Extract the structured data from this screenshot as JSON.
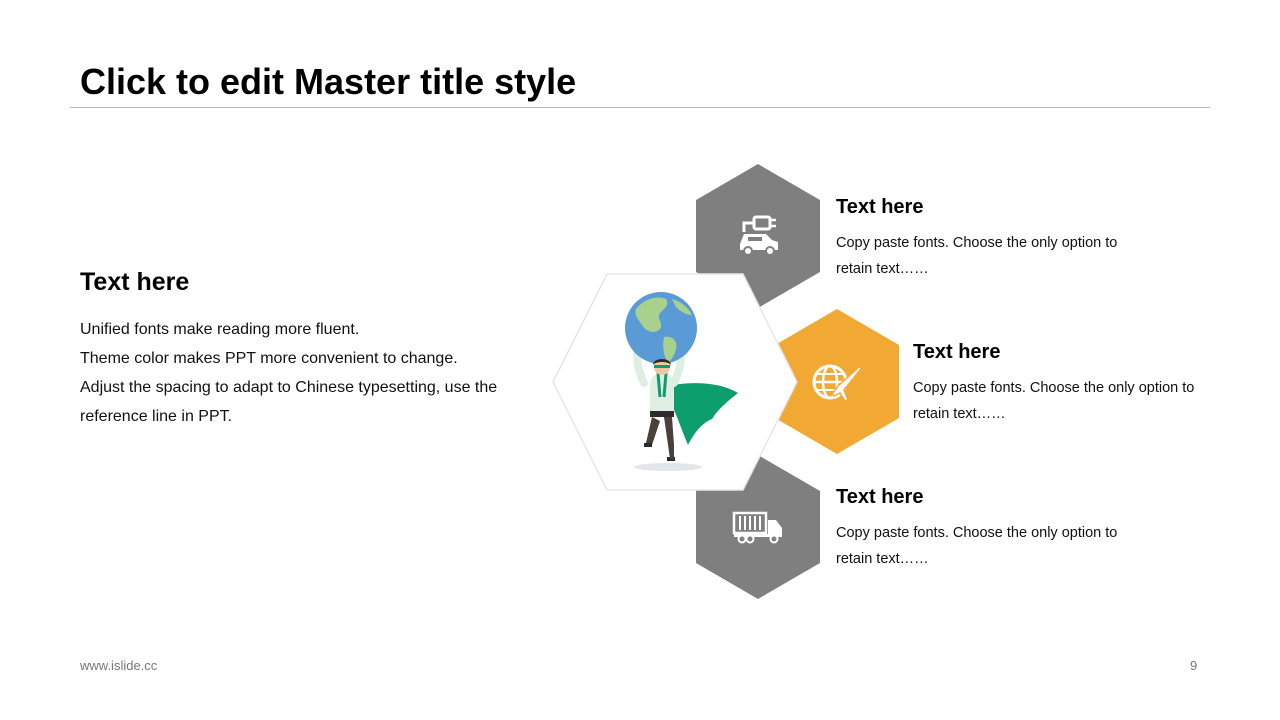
{
  "slide": {
    "title": "Click to edit Master title style",
    "footer_url": "www.islide.cc",
    "page_number": "9"
  },
  "left": {
    "heading": "Text here",
    "lines": [
      "Unified fonts make reading more fluent.",
      "Theme color makes PPT more convenient to change.",
      "Adjust the spacing to adapt to Chinese typesetting, use the",
      "reference line in PPT."
    ]
  },
  "items": [
    {
      "heading": "Text here",
      "text": "Copy paste fonts. Choose the only option to retain text……",
      "icon": "car-charging-icon",
      "color": "#7f7f7f"
    },
    {
      "heading": "Text here",
      "text": "Copy paste fonts. Choose the only option to retain text……",
      "icon": "globe-plane-icon",
      "color": "#f2a933"
    },
    {
      "heading": "Text here",
      "text": "Copy paste fonts. Choose the only option to retain text……",
      "icon": "truck-icon",
      "color": "#7f7f7f"
    }
  ],
  "colors": {
    "accent": "#f2a933",
    "gray": "#7f7f7f",
    "hero_cape": "#0d9e6e",
    "globe_ocean": "#5b9bd5",
    "globe_land": "#a9d18e"
  }
}
